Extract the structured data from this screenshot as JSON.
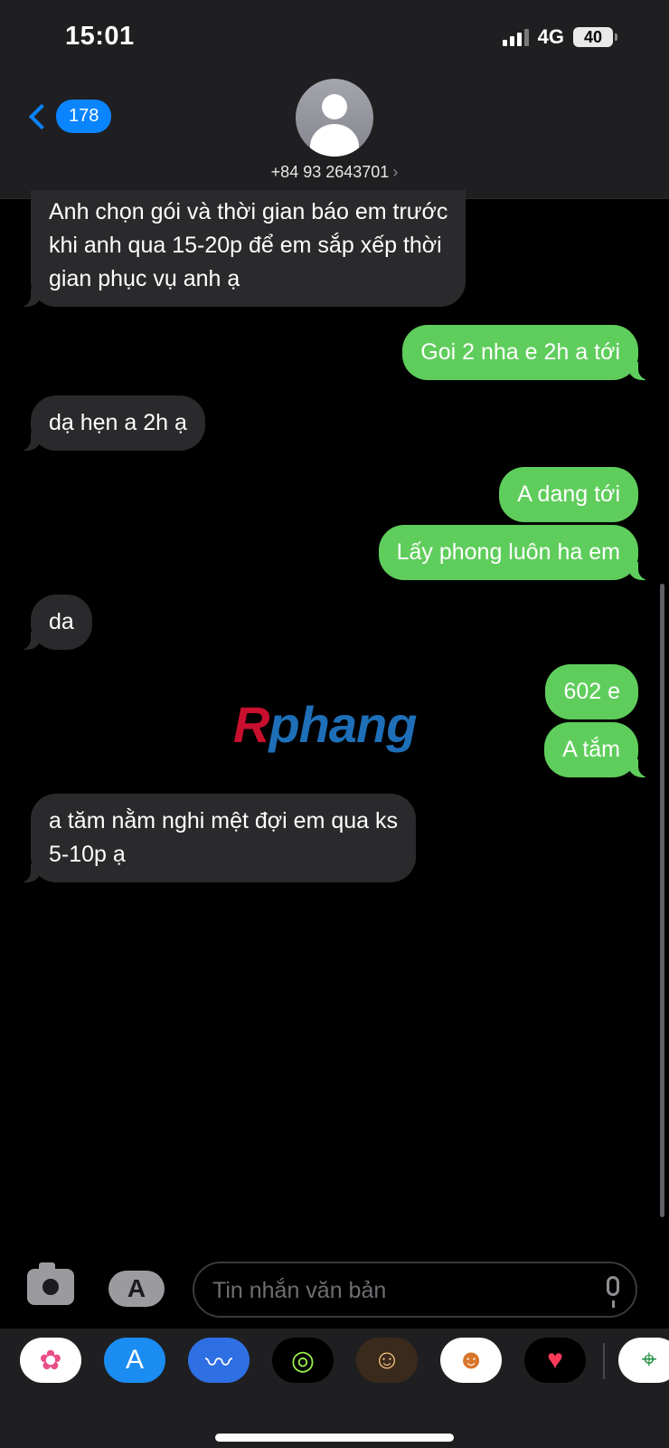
{
  "status_bar": {
    "time": "15:01",
    "network": "4G",
    "battery": "40"
  },
  "header": {
    "back_count": "178",
    "contact_number": "+84 93 2643701",
    "chevron": "›"
  },
  "messages": [
    {
      "dir": "in",
      "lines": [
        "Anh chọn gói và thời gian báo em trước",
        "khi anh qua 15-20p để em sắp xếp thời",
        "gian phục vụ anh ạ"
      ]
    },
    {
      "dir": "out",
      "text": "Goi 2 nha e 2h a tới"
    },
    {
      "dir": "in",
      "text": "dạ hẹn a 2h ạ"
    },
    {
      "dir": "out",
      "text": "A dang tới"
    },
    {
      "dir": "out",
      "text": "Lấy phong luôn ha em"
    },
    {
      "dir": "in",
      "text": "da"
    },
    {
      "dir": "out",
      "text": "602 e"
    },
    {
      "dir": "out",
      "text": "A tắm"
    },
    {
      "dir": "in",
      "lines": [
        "a tăm nằm nghi mệt đợi em qua ks",
        "5-10p ạ"
      ]
    }
  ],
  "watermark": {
    "part1": "R",
    "part2": "phang"
  },
  "composer": {
    "placeholder": "Tin nhắn văn bản",
    "apps_glyph": "A"
  },
  "app_drawer": {
    "apps": [
      {
        "name": "photos-icon",
        "glyph": "✿",
        "bg": "#ffffff",
        "fg": "#e84f86"
      },
      {
        "name": "app-store-icon",
        "glyph": "A",
        "bg": "#1b8cf2",
        "fg": "#ffffff"
      },
      {
        "name": "audio-message-icon",
        "glyph": "〰",
        "bg": "#2f6fe4",
        "fg": "#ffffff"
      },
      {
        "name": "activity-icon",
        "glyph": "◎",
        "bg": "#000000",
        "fg": "#9df24b"
      },
      {
        "name": "memoji-icon",
        "glyph": "☺",
        "bg": "#3a2a1c",
        "fg": "#f4c27a"
      },
      {
        "name": "animoji-icon",
        "glyph": "☻",
        "bg": "#ffffff",
        "fg": "#d9762b"
      },
      {
        "name": "digital-touch-icon",
        "glyph": "♥",
        "bg": "#000000",
        "fg": "#ff3b5c"
      },
      {
        "name": "maps-icon",
        "glyph": "⌖",
        "bg": "#ffffff",
        "fg": "#1e8e3e"
      }
    ]
  }
}
